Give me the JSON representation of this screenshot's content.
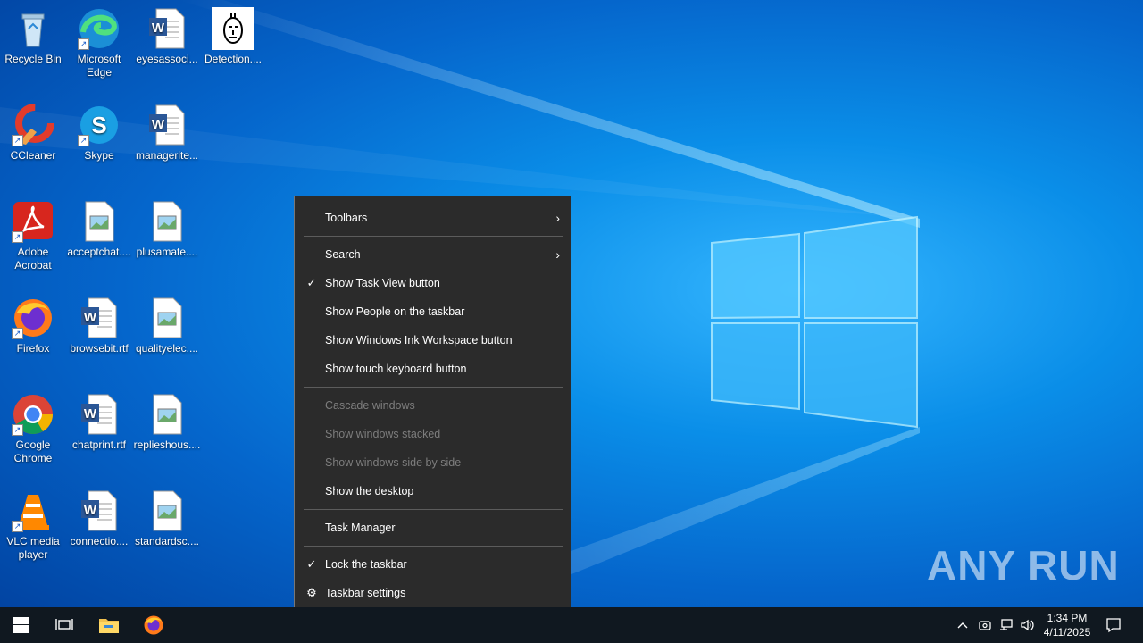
{
  "desktop": {
    "icons": [
      {
        "label": "Recycle Bin",
        "icon": "recycle-bin-icon"
      },
      {
        "label": "Microsoft Edge",
        "icon": "edge-icon"
      },
      {
        "label": "eyesassoci...",
        "icon": "word-doc-icon"
      },
      {
        "label": "Detection....",
        "icon": "detection-image-icon"
      },
      {
        "label": "CCleaner",
        "icon": "ccleaner-icon"
      },
      {
        "label": "Skype",
        "icon": "skype-icon"
      },
      {
        "label": "managerite...",
        "icon": "word-doc-icon"
      },
      {
        "label": "Adobe Acrobat",
        "icon": "acrobat-icon"
      },
      {
        "label": "acceptchat....",
        "icon": "image-file-icon"
      },
      {
        "label": "plusamate....",
        "icon": "image-file-icon"
      },
      {
        "label": "Firefox",
        "icon": "firefox-icon"
      },
      {
        "label": "browsebit.rtf",
        "icon": "word-doc-icon"
      },
      {
        "label": "qualityelec....",
        "icon": "image-file-icon"
      },
      {
        "label": "Google Chrome",
        "icon": "chrome-icon"
      },
      {
        "label": "chatprint.rtf",
        "icon": "word-doc-icon"
      },
      {
        "label": "replieshous....",
        "icon": "image-file-icon"
      },
      {
        "label": "VLC media player",
        "icon": "vlc-icon"
      },
      {
        "label": "connectio....",
        "icon": "word-doc-icon"
      },
      {
        "label": "standardsc....",
        "icon": "image-file-icon"
      }
    ]
  },
  "context_menu": {
    "toolbars": "Toolbars",
    "search": "Search",
    "show_task_view": "Show Task View button",
    "show_people": "Show People on the taskbar",
    "show_ink": "Show Windows Ink Workspace button",
    "show_touch_kb": "Show touch keyboard button",
    "cascade": "Cascade windows",
    "stacked": "Show windows stacked",
    "side_by_side": "Show windows side by side",
    "show_desktop": "Show the desktop",
    "task_manager": "Task Manager",
    "lock_taskbar": "Lock the taskbar",
    "taskbar_settings": "Taskbar settings",
    "check_glyph": "✓",
    "arrow_glyph": "›",
    "gear_glyph": "⚙"
  },
  "taskbar": {
    "clock_time": "1:34 PM",
    "clock_date": "4/11/2025"
  },
  "watermark": "ANY RUN",
  "colors": {
    "menu_bg": "#2b2b2b",
    "taskbar_bg": "#101820",
    "desktop_blue": "#0a8ee8"
  }
}
